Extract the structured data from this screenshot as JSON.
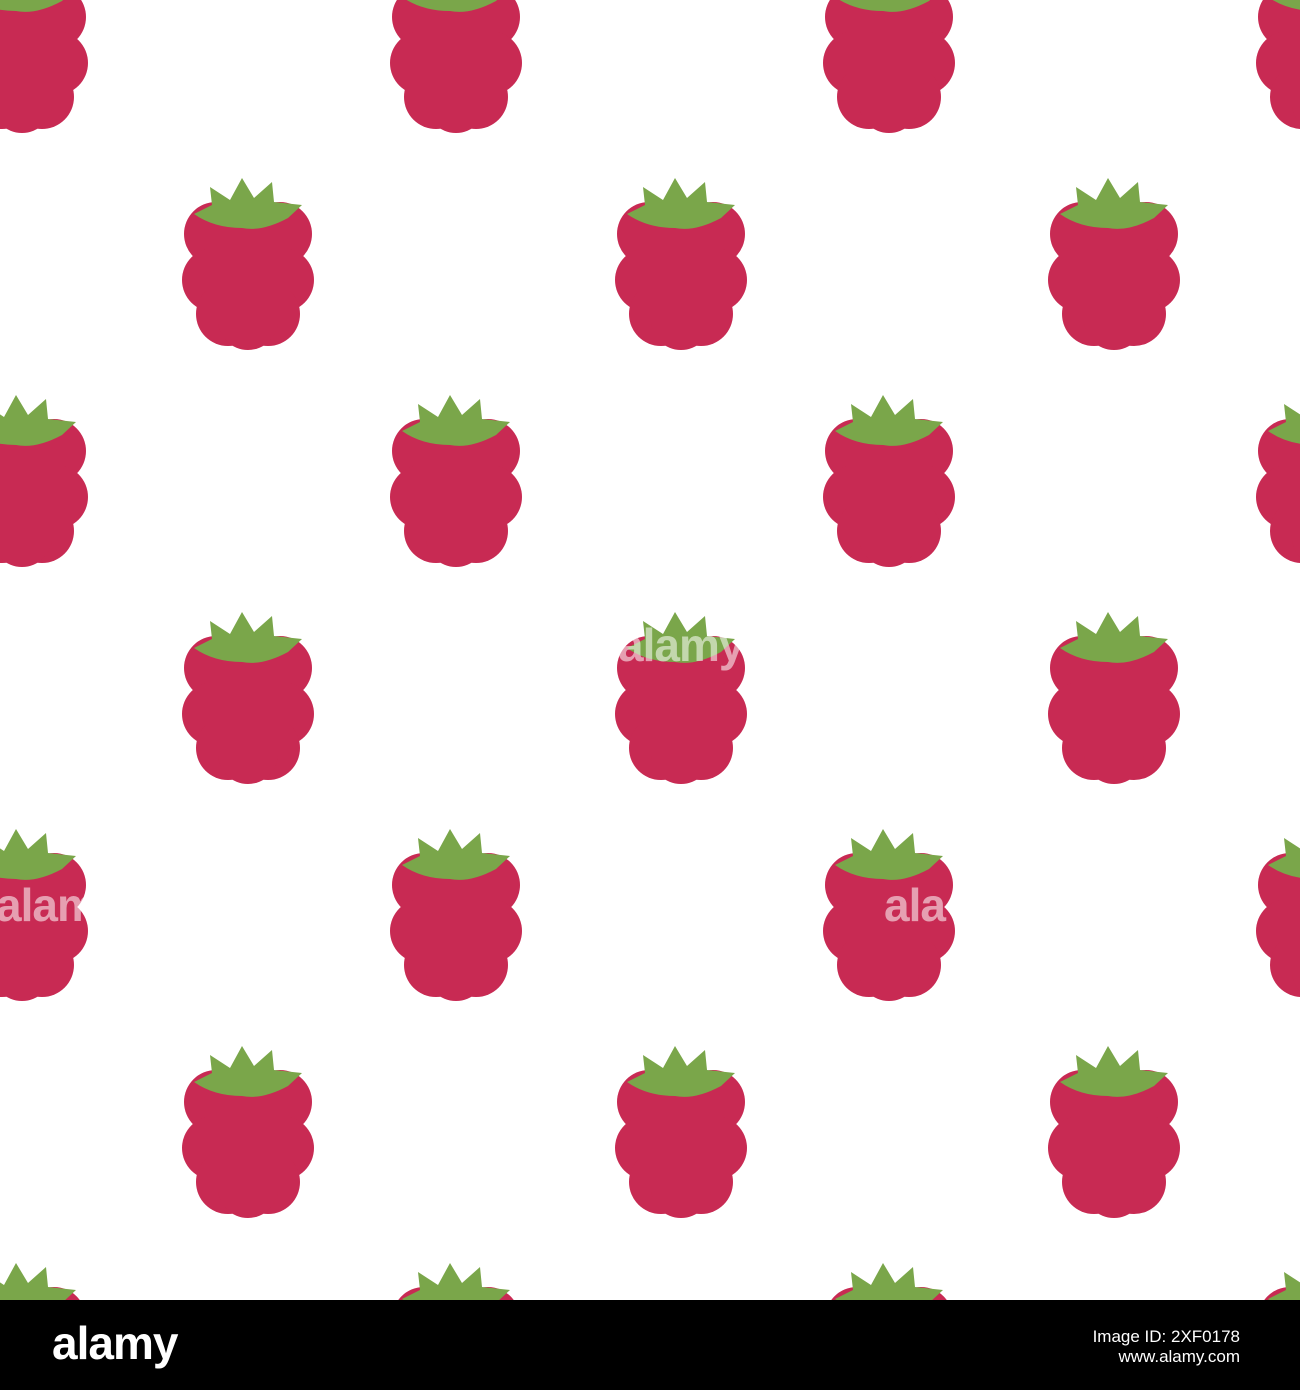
{
  "colors": {
    "background": "#ffffff",
    "berry": "#c82a53",
    "leaf": "#7aa64a",
    "footer_background": "#000000",
    "footer_text": "#ffffff",
    "watermark": "#ffffff"
  },
  "pattern": {
    "motif": "raspberry-icon",
    "description": "seamless repeating raspberry pattern"
  },
  "watermark": {
    "center": "alamy",
    "left": "alamy",
    "right": "ala"
  },
  "footer": {
    "logo": "alamy",
    "image_id_line": "Image ID: 2XF0178",
    "url": "www.alamy.com"
  }
}
